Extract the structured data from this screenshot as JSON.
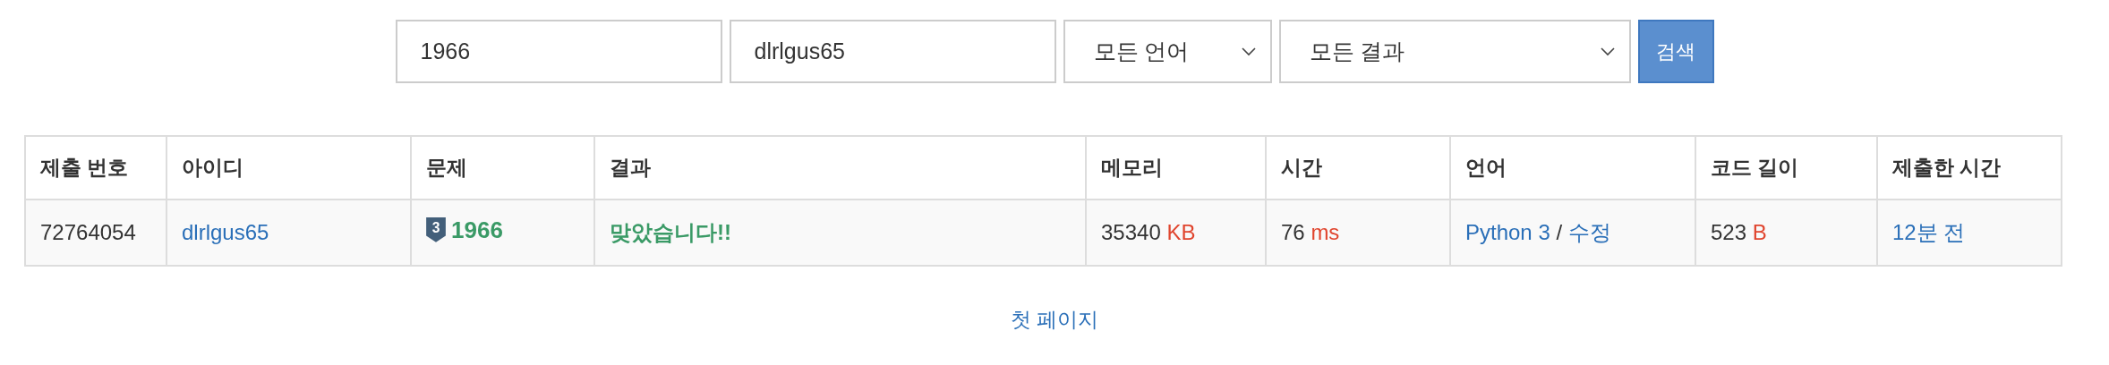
{
  "search": {
    "problem_id": "1966",
    "user_id": "dlrlgus65",
    "language": "모든 언어",
    "result": "모든 결과",
    "button": "검색"
  },
  "table": {
    "columns": [
      "제출 번호",
      "아이디",
      "문제",
      "결과",
      "메모리",
      "시간",
      "언어",
      "코드 길이",
      "제출한 시간"
    ],
    "rows": [
      {
        "submission_id": "72764054",
        "user": "dlrlgus65",
        "problem": {
          "tier": "3",
          "number": "1966"
        },
        "result": "맞았습니다!!",
        "memory": {
          "value": "35340",
          "unit": "KB"
        },
        "time": {
          "value": "76",
          "unit": "ms"
        },
        "language": {
          "name": "Python 3",
          "separator": "/",
          "edit": "수정"
        },
        "code_length": {
          "value": "523",
          "unit": "B"
        },
        "submitted": "12분 전"
      }
    ]
  },
  "pagination": {
    "first_page": "첫 페이지"
  }
}
